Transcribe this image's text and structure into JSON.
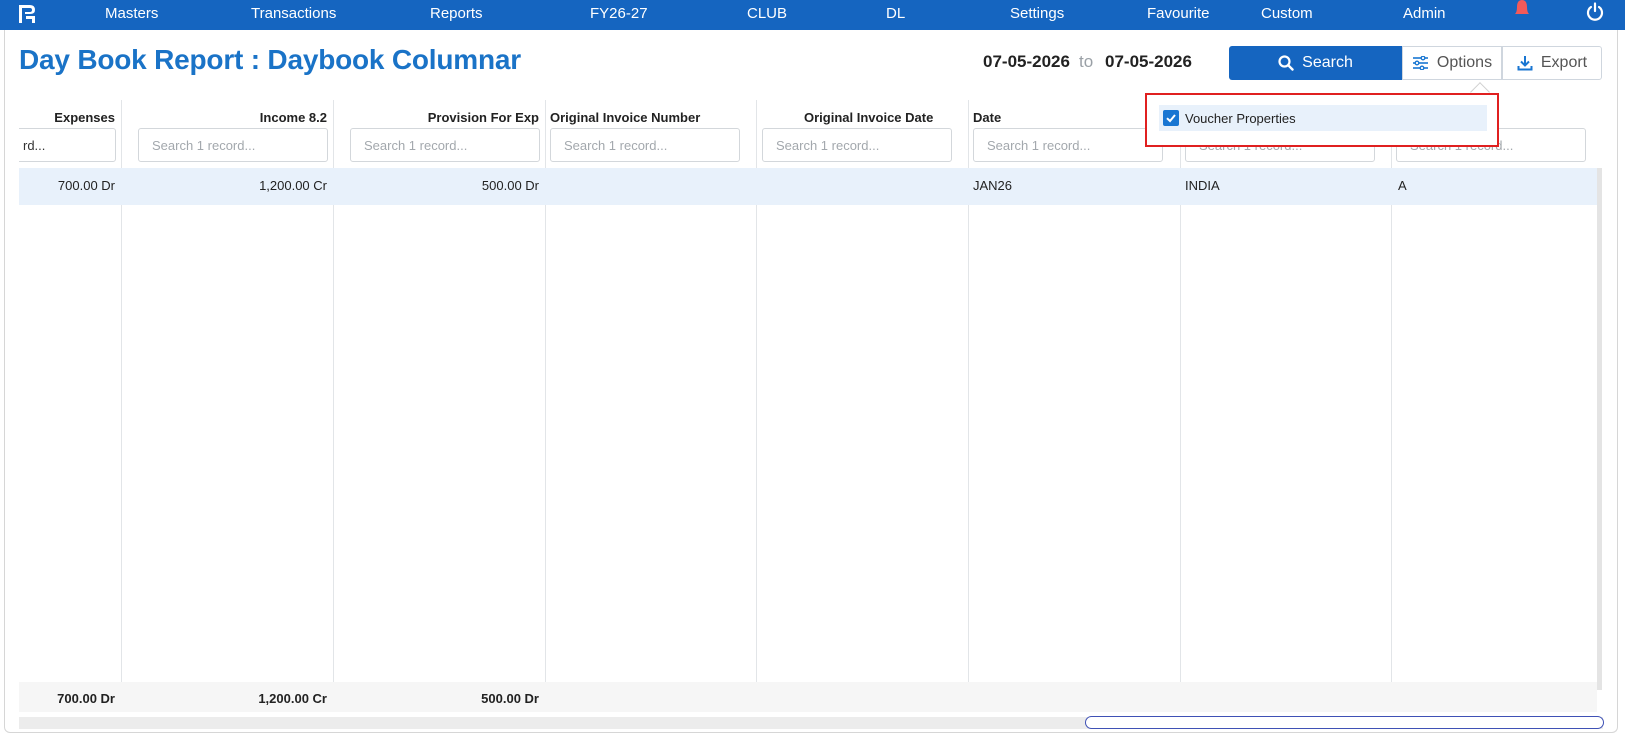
{
  "nav": {
    "items": [
      "Masters",
      "Transactions",
      "Reports",
      "FY26-27",
      "CLUB",
      "DL",
      "Settings",
      "Favourite",
      "Custom",
      "Admin"
    ]
  },
  "page": {
    "title": "Day Book Report : Daybook Columnar",
    "date_from": "07-05-2026",
    "date_separator": "to",
    "date_to": "07-05-2026"
  },
  "toolbar": {
    "search_label": "Search",
    "options_label": "Options",
    "export_label": "Export"
  },
  "options_menu": {
    "items": [
      {
        "label": "Voucher Properties",
        "checked": true
      }
    ]
  },
  "grid": {
    "columns": [
      {
        "header": "Expenses",
        "filter_value": "rd...",
        "filter_placeholder": ""
      },
      {
        "header": "Income 8.2",
        "filter_value": "",
        "filter_placeholder": "Search 1 record..."
      },
      {
        "header": "Provision For Exp",
        "filter_value": "",
        "filter_placeholder": "Search 1 record..."
      },
      {
        "header": "Original Invoice Number",
        "filter_value": "",
        "filter_placeholder": "Search 1 record..."
      },
      {
        "header": "Original Invoice Date",
        "filter_value": "",
        "filter_placeholder": "Search 1 record..."
      },
      {
        "header": "Date",
        "filter_value": "",
        "filter_placeholder": "Search 1 record..."
      },
      {
        "header": "",
        "filter_value": "",
        "filter_placeholder": "Search 1 record..."
      },
      {
        "header": "",
        "filter_value": "",
        "filter_placeholder": "Search 1 record..."
      }
    ],
    "rows": [
      [
        "700.00 Dr",
        "1,200.00 Cr",
        "500.00 Dr",
        "",
        "",
        "JAN26",
        "INDIA",
        "A"
      ]
    ],
    "totals": [
      "700.00 Dr",
      "1,200.00 Cr",
      "500.00 Dr",
      "",
      "",
      "",
      "",
      ""
    ]
  },
  "colors": {
    "nav_bg": "#1565c0",
    "title": "#1a73c7",
    "row_highlight": "#e8f1fb",
    "dropdown_border": "#e02020"
  },
  "icons": {
    "logo": "app-logo-icon",
    "bell": "bell-icon",
    "power": "power-icon",
    "search": "search-icon",
    "options": "sliders-icon",
    "export": "download-icon",
    "check": "check-icon"
  }
}
